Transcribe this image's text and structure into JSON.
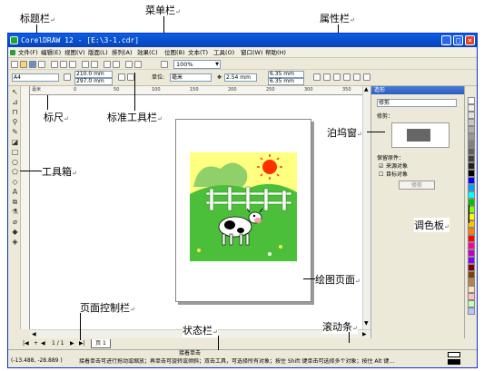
{
  "annotations": {
    "title_bar": "标题栏",
    "menu_bar": "菜单栏",
    "property_bar": "属性栏",
    "ruler": "标尺",
    "standard_toolbar": "标准工具栏",
    "toolbox": "工具箱",
    "docker": "泊坞窗",
    "palette": "调色板",
    "drawing_page": "绘图页面",
    "page_control": "页面控制栏",
    "status_bar": "状态栏",
    "scrollbar": "滚动条",
    "mark": "↵"
  },
  "window": {
    "title": "CorelDRAW 12 - [E:\\3-1.cdr]",
    "min": "_",
    "max": "□",
    "close": "×"
  },
  "menu": [
    "文件(F)",
    "编辑(E)",
    "视图(V)",
    "版面(L)",
    "排列(A)",
    "效果(C)",
    "位图(B)",
    "文本(T)",
    "工具(O)",
    "窗口(W)",
    "帮助(H)"
  ],
  "toolbar": {
    "zoom": "100%"
  },
  "propbar": {
    "page_size": "A4",
    "width": "210.0 mm",
    "height": "297.0 mm",
    "units_label": "单位:",
    "units": "毫米",
    "nudge": "2.54 mm",
    "dup_x": "6.35 mm",
    "dup_y": "6.35 mm"
  },
  "ruler": {
    "unit": "毫米",
    "ticks": [
      "0",
      "50",
      "100",
      "150",
      "200",
      "250",
      "300",
      "350"
    ]
  },
  "docker": {
    "tab": "造形",
    "mode": "修剪",
    "section": "修剪：",
    "keep_label": "保留原件：",
    "source_label": "来源对象",
    "target_label": "目标对象",
    "button": "修剪",
    "source_checked": true,
    "target_checked": false
  },
  "pagectrl": {
    "page_of": "1 / 1",
    "tab": "页 1"
  },
  "status": {
    "coords": "(-13.488, -28.889 )",
    "hint_top": "接着单击",
    "message": "接着单击可进行拖动或缩放；再单击可旋转或倾斜；双击工具，可选择所有对象；按住 Shift 键单击可选择多个对象；按住 Alt 键单…"
  },
  "colors": {
    "titlebar": "#0842b8",
    "sky": "#ffff80",
    "grass": "#4cbf3a",
    "fence": "#ffffff",
    "sun": "#ff3000"
  },
  "palette_colors": [
    "#ffffff",
    "#f0f0f0",
    "#e0e0e0",
    "#c8c8c8",
    "#b0b0b0",
    "#989898",
    "#808080",
    "#606060",
    "#404040",
    "#202020",
    "#000000",
    "#0000ff",
    "#00a0ff",
    "#00ffff",
    "#00c000",
    "#80ff00",
    "#ffff00",
    "#ffc000",
    "#ff8000",
    "#ff0000",
    "#ff00a0",
    "#c000c0",
    "#8000ff",
    "#800000",
    "#804000",
    "#c08040",
    "#ffe0c0",
    "#ffc0c0",
    "#c0ffc0",
    "#c0c0ff"
  ]
}
